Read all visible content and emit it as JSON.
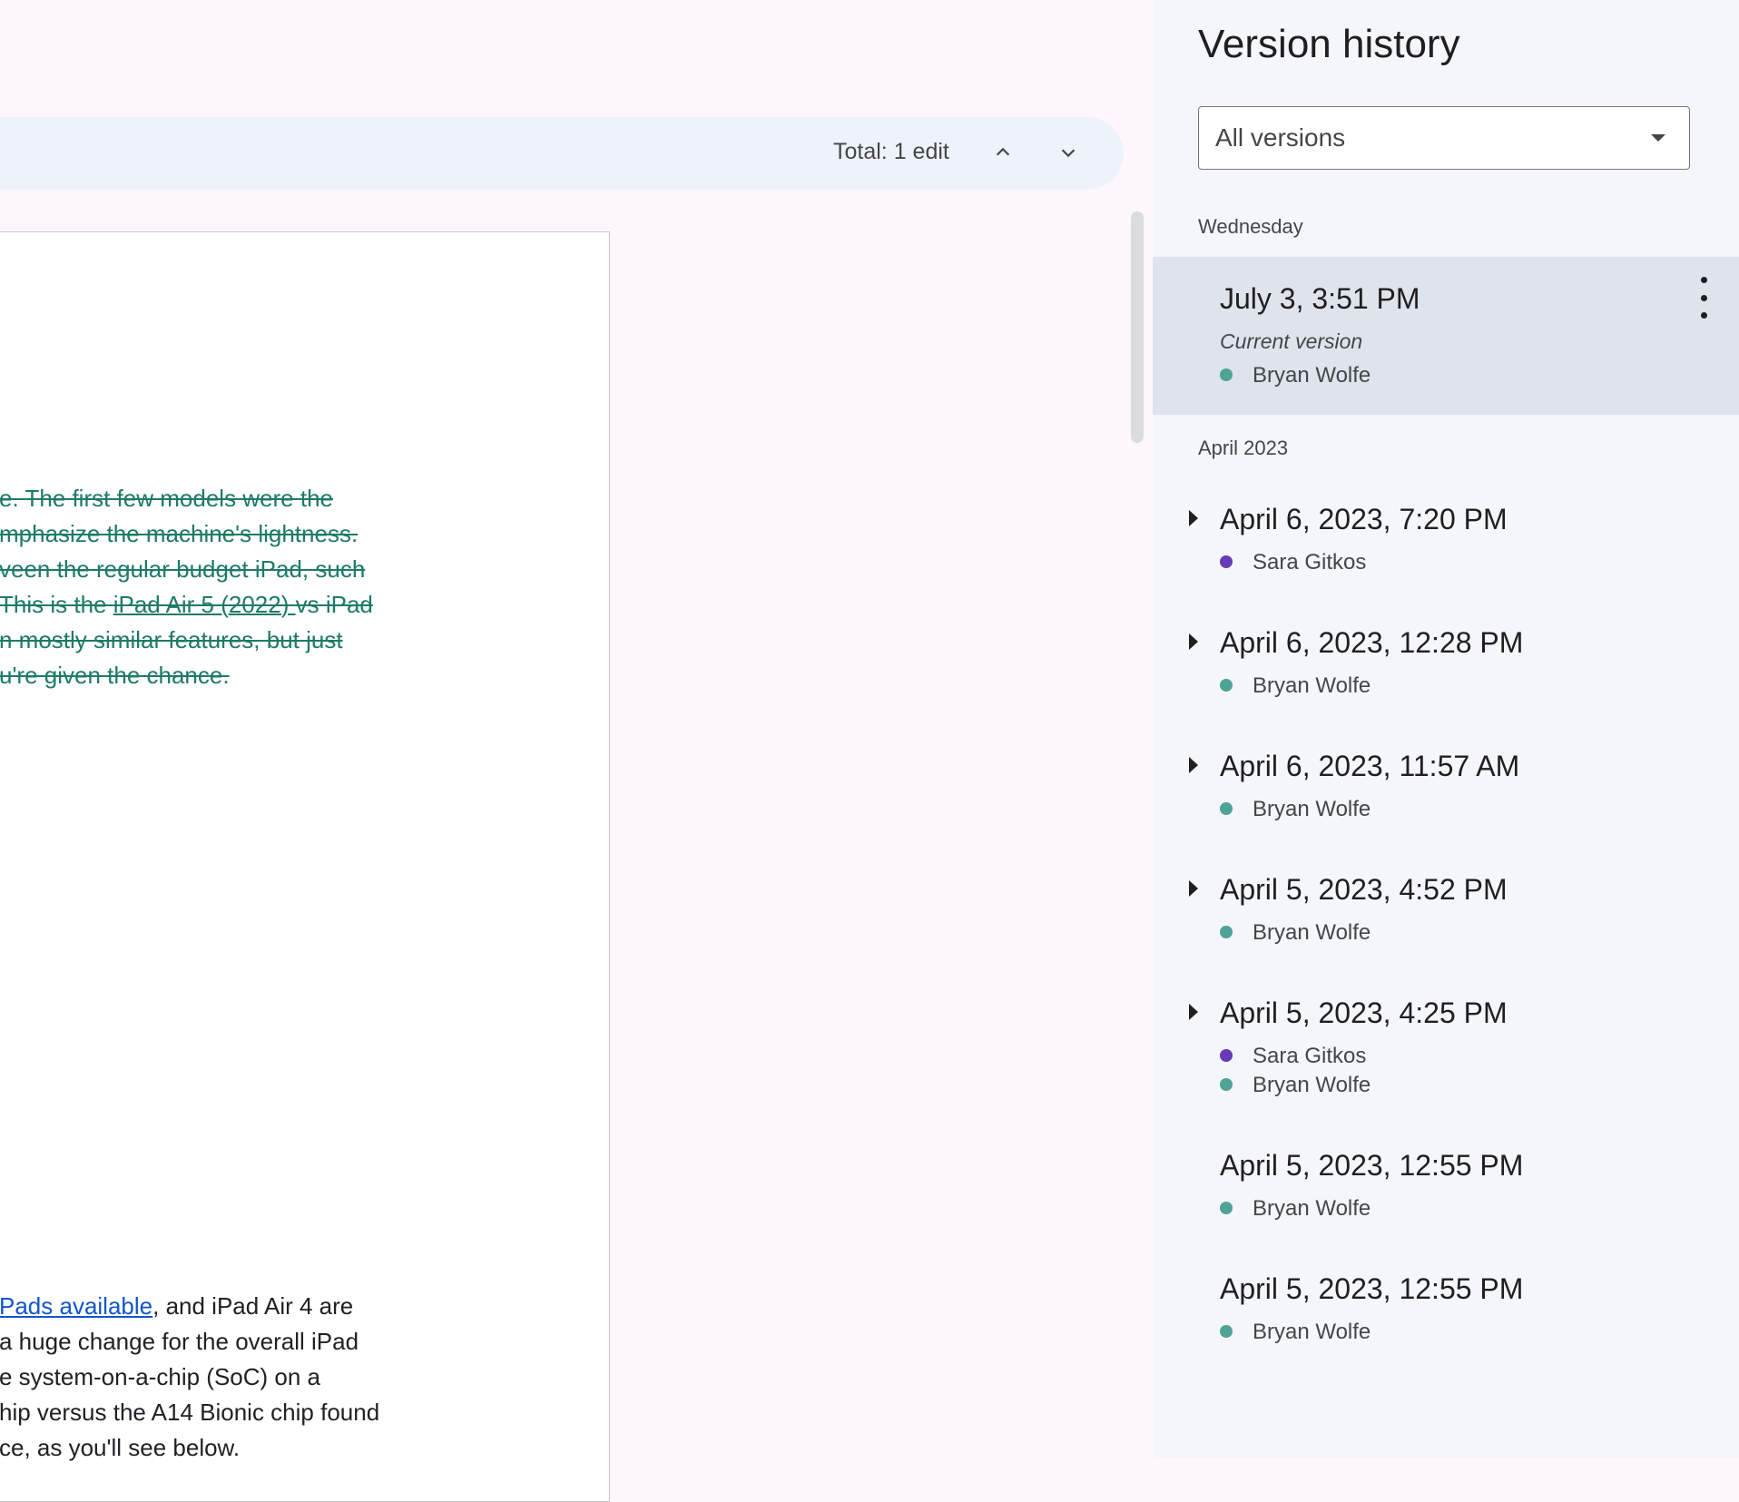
{
  "toolbar": {
    "total_edits": "Total: 1 edit",
    "prev_icon": "chevron-up-icon",
    "next_icon": "chevron-down-icon"
  },
  "document": {
    "deleted_lines": [
      "e. The first few models were the",
      "mphasize the machine's lightness.",
      "veen the regular budget iPad, such",
      "This is the ",
      "n mostly similar features, but just",
      "u're given the chance."
    ],
    "deleted_line4_link": "iPad Air 5 (2022) ",
    "deleted_line4_tail": "vs iPad",
    "body_link": "Pads available",
    "body_lines": [
      ", and iPad Air 4 are",
      "a huge change for the overall iPad",
      "e system-on-a-chip (SoC) on a",
      "hip versus the A14 Bionic chip found",
      "ce, as you'll see below."
    ]
  },
  "sidebar": {
    "title": "Version history",
    "filter": {
      "value": "All versions"
    },
    "groups": [
      {
        "label": "Wednesday"
      },
      {
        "label": "April 2023"
      }
    ],
    "current": {
      "title": "July 3, 3:51 PM",
      "subtitle": "Current version",
      "author": "Bryan Wolfe"
    },
    "versions": [
      {
        "title": "April 6, 2023, 7:20 PM",
        "authors": [
          "Sara Gitkos"
        ]
      },
      {
        "title": "April 6, 2023, 12:28 PM",
        "authors": [
          "Bryan Wolfe"
        ]
      },
      {
        "title": "April 6, 2023, 11:57 AM",
        "authors": [
          "Bryan Wolfe"
        ]
      },
      {
        "title": "April 5, 2023, 4:52 PM",
        "authors": [
          "Bryan Wolfe"
        ]
      },
      {
        "title": "April 5, 2023, 4:25 PM",
        "authors": [
          "Sara Gitkos",
          "Bryan Wolfe"
        ]
      },
      {
        "title": "April 5, 2023, 12:55 PM",
        "authors": [
          "Bryan Wolfe"
        ]
      },
      {
        "title": "April 5, 2023, 12:55 PM",
        "authors": [
          "Bryan Wolfe"
        ]
      }
    ]
  },
  "colors": {
    "bryan": "#4fa394",
    "sara": "#673ab7",
    "deleted_text": "#1e7a68",
    "link": "#1155cc"
  }
}
